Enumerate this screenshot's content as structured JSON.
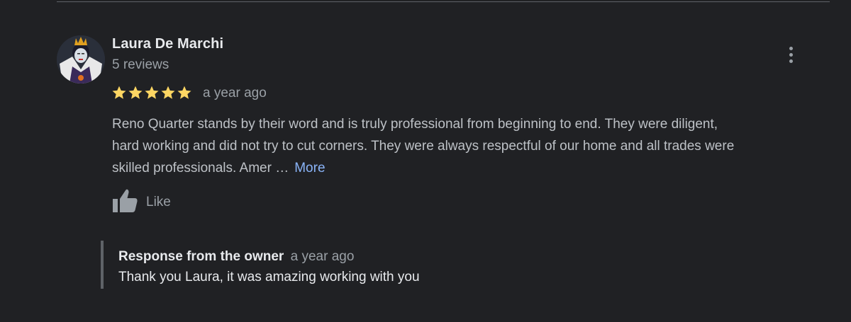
{
  "review": {
    "reviewer_name": "Laura De Marchi",
    "reviewer_review_count": "5 reviews",
    "rating": 5,
    "rating_max": 5,
    "date": "a year ago",
    "text_lines": [
      "Reno Quarter stands by their word and is truly professional from beginning to end. They were diligent,",
      "hard working and did not try to cut corners. They were always respectful of our home and all trades were",
      "skilled professionals. Amer …"
    ],
    "more_label": "More",
    "like_label": "Like",
    "icons": {
      "avatar": "profile-photo",
      "menu": "more-vert-icon",
      "star": "star-icon",
      "like": "thumbs-up-icon"
    },
    "colors": {
      "background": "#202124",
      "star": "#fdd663",
      "link": "#8ab4f8",
      "primary_text": "#e8eaed",
      "secondary_text": "#9aa0a6"
    }
  },
  "owner_response": {
    "title": "Response from the owner",
    "date": "a year ago",
    "text": "Thank you Laura, it was amazing working with you"
  }
}
